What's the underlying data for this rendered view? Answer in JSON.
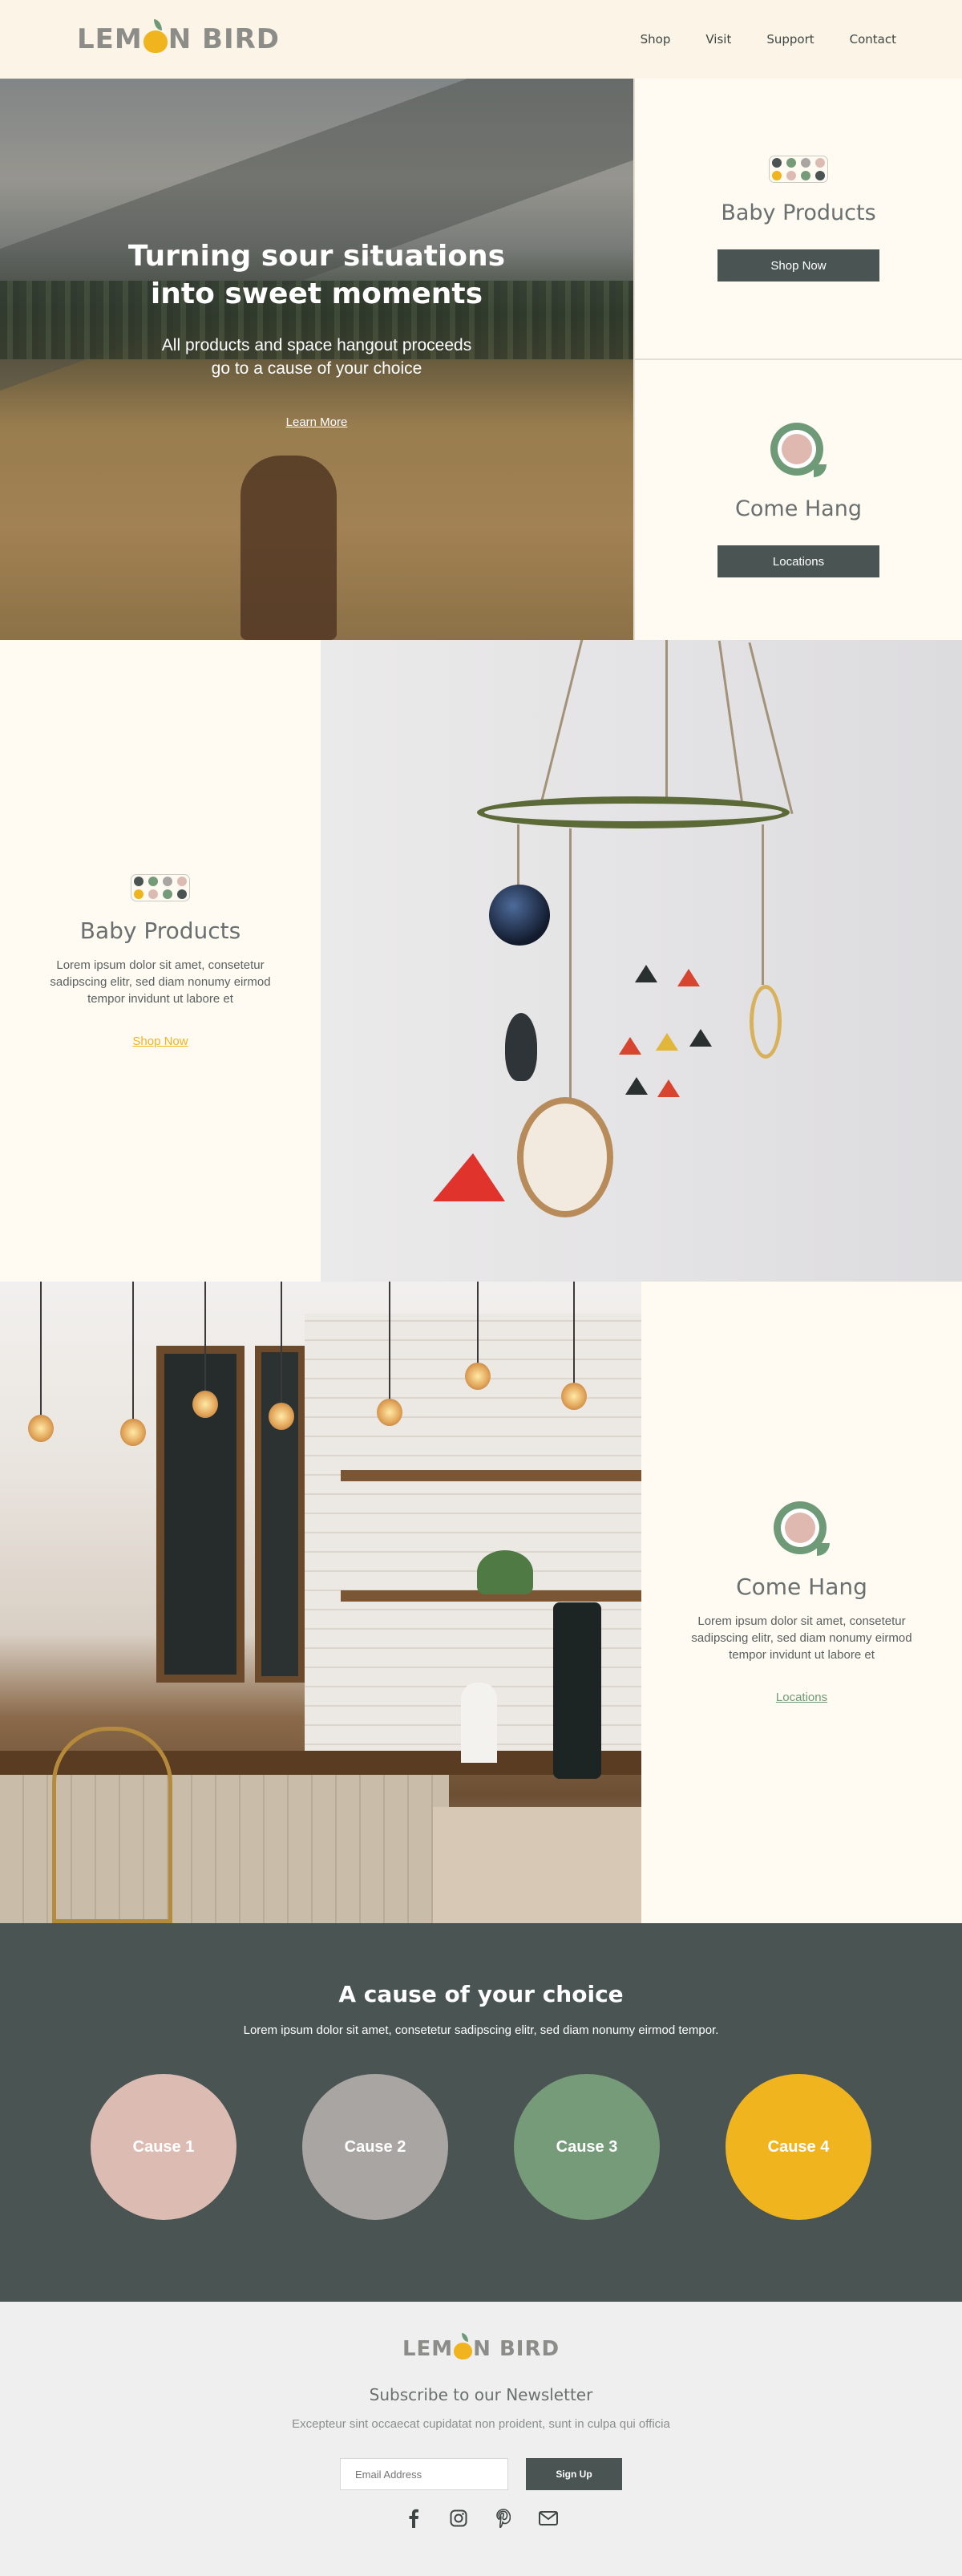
{
  "brand": {
    "name_left": "LEM",
    "name_right": "N BIRD"
  },
  "nav": {
    "items": [
      "Shop",
      "Visit",
      "Support",
      "Contact"
    ]
  },
  "hero": {
    "title_line1": "Turning sour situations",
    "title_line2": "into sweet moments",
    "subtitle_line1": "All products and space hangout proceeds",
    "subtitle_line2": "go to a cause of your choice",
    "link": "Learn More"
  },
  "side_cards": [
    {
      "title": "Baby Products",
      "button": "Shop Now",
      "icon": "dot-grid-icon"
    },
    {
      "title": "Come Hang",
      "button": "Locations",
      "icon": "magnifier-icon"
    }
  ],
  "features": [
    {
      "title": "Baby Products",
      "body": "Lorem ipsum dolor sit amet, consetetur sadipscing elitr, sed diam nonumy eirmod tempor invidunt ut labore et",
      "link": "Shop Now",
      "link_color": "#f0b41f"
    },
    {
      "title": "Come Hang",
      "body": "Lorem ipsum dolor sit amet, consetetur sadipscing elitr, sed diam nonumy eirmod tempor invidunt ut labore et",
      "link": "Locations",
      "link_color": "#6f9a77"
    }
  ],
  "causes": {
    "title": "A cause of your choice",
    "text": "Lorem ipsum dolor sit amet, consetetur sadipscing elitr, sed diam nonumy eirmod tempor.",
    "items": [
      {
        "label": "Cause 1",
        "color": "#dcbcb2"
      },
      {
        "label": "Cause 2",
        "color": "#a9a5a2"
      },
      {
        "label": "Cause 3",
        "color": "#769b79"
      },
      {
        "label": "Cause 4",
        "color": "#f0b41f"
      }
    ]
  },
  "footer": {
    "newsletter_title": "Subscribe to our Newsletter",
    "newsletter_text": "Excepteur sint occaecat cupidatat non proident, sunt in culpa qui officia",
    "email_placeholder": "Email Address",
    "signup": "Sign Up",
    "social": [
      "facebook-icon",
      "instagram-icon",
      "pinterest-icon",
      "mail-icon"
    ]
  },
  "colors": {
    "dark": "#4a5453",
    "lemon": "#f0b41f",
    "sage": "#6f9a77",
    "blush": "#dfb8af",
    "cream": "#fcf4e6"
  },
  "dot_colors": [
    "#4a5453",
    "#769b79",
    "#a9a5a2",
    "#dcbcb2",
    "#f0b41f",
    "#dcbcb2",
    "#769b79",
    "#4a5453"
  ]
}
